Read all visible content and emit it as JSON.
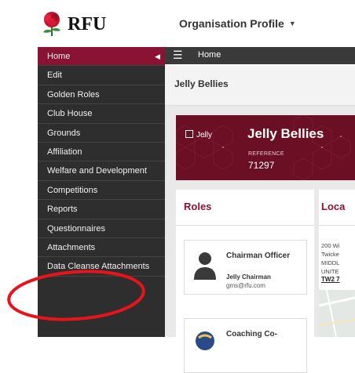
{
  "brand": {
    "wordmark": "RFU"
  },
  "header": {
    "org_menu_label": "Organisation Profile",
    "org_menu_caret": "▼"
  },
  "sidebar": {
    "items": [
      {
        "label": "Home",
        "active": true
      },
      {
        "label": "Edit"
      },
      {
        "label": "Golden Roles"
      },
      {
        "label": "Club House"
      },
      {
        "label": "Grounds"
      },
      {
        "label": "Affiliation"
      },
      {
        "label": "Welfare and Development"
      },
      {
        "label": "Competitions"
      },
      {
        "label": "Reports"
      },
      {
        "label": "Questionnaires"
      },
      {
        "label": "Attachments"
      },
      {
        "label": "Data Cleanse Attachments"
      }
    ],
    "collapse_arrow": "◀"
  },
  "topbar": {
    "menu_glyph": "☰",
    "breadcrumb": "Home"
  },
  "page": {
    "subtitle": "Jelly Bellies"
  },
  "club": {
    "short_name": "Jelly",
    "name": "Jelly Bellies",
    "reference_label": "REFERENCE",
    "reference_value": "71297"
  },
  "roles": {
    "title": "Roles",
    "people": [
      {
        "role": "Chairman Officer",
        "name": "Jelly Chairman",
        "email": "gms@rfu.com"
      },
      {
        "role": "Coaching Co-",
        "name": "",
        "email": ""
      }
    ]
  },
  "location": {
    "title": "Loca",
    "address_lines": [
      "200 Wi",
      "Twicke",
      "MIDDL",
      "UNITE"
    ],
    "postcode": "TW2 7"
  },
  "colors": {
    "brand_red": "#8a1333",
    "sidebar_bg": "#2e2e2e",
    "annotation": "#e8141b"
  },
  "icons": [
    "rose-logo-icon",
    "hamburger-menu-icon",
    "collapse-arrow-icon",
    "club-badge-icon",
    "avatar-icon",
    "dropdown-caret-icon"
  ]
}
